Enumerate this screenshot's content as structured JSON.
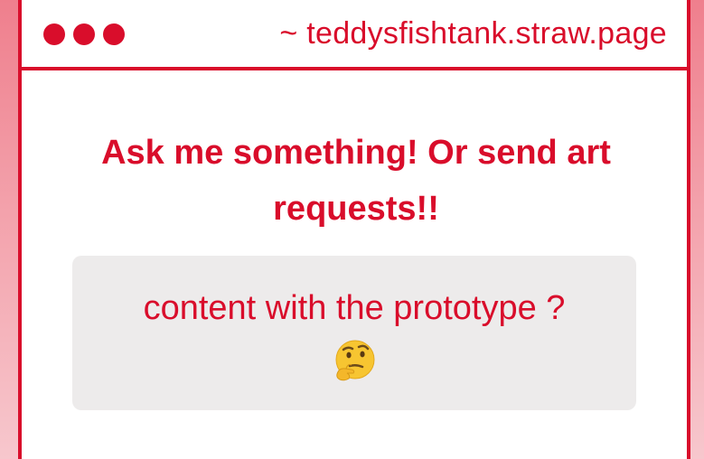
{
  "window": {
    "url": "~ teddysfishtank.straw.page",
    "controls": [
      "dot",
      "dot",
      "dot"
    ]
  },
  "question": {
    "text": "Ask me something! Or send art requests!!"
  },
  "answer": {
    "text": "content with the prototype ?",
    "emoji": "thinking-face-icon"
  },
  "colors": {
    "accent": "#d90d2b",
    "box_background": "#edebeb",
    "background_top": "#ef7f8d",
    "background_bottom": "#f7c7cd"
  }
}
